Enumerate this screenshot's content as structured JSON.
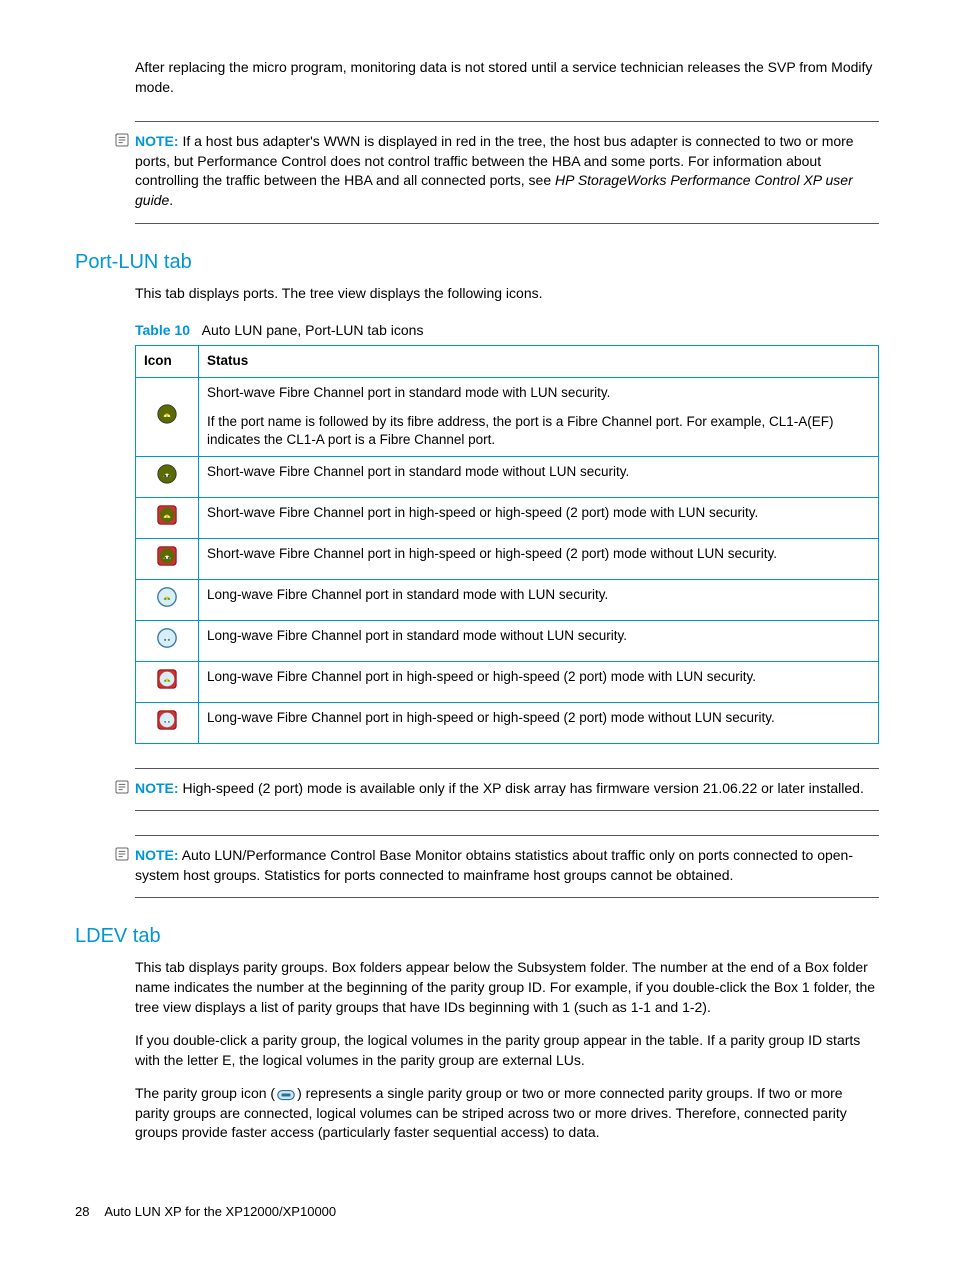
{
  "intro_paragraph": "After replacing the micro program, monitoring data is not stored until a service technician releases the SVP from Modify mode.",
  "note1": {
    "label": "NOTE:",
    "text_prefix": "If a host bus adapter's WWN is displayed in red in the tree, the host bus adapter is connected to two or more ports, but Performance Control does not control traffic between the HBA and some ports. For information about controlling the traffic between the HBA and all connected ports, see ",
    "italic": "HP StorageWorks Performance Control XP user guide",
    "text_suffix": "."
  },
  "port_lun": {
    "heading": "Port-LUN tab",
    "intro": "This tab displays ports. The tree view displays the following icons.",
    "table_label": "Table 10",
    "table_caption": "Auto LUN pane, Port-LUN tab icons",
    "columns": {
      "icon": "Icon",
      "status": "Status"
    },
    "rows": [
      {
        "icon_name": "sw-std-lun",
        "status_line1": "Short-wave Fibre Channel port in standard mode with LUN security.",
        "status_line2": "If the port name is followed by its fibre address, the port is a Fibre Channel port. For example, CL1-A(EF) indicates the CL1-A port is a Fibre Channel port."
      },
      {
        "icon_name": "sw-std-nolun",
        "status": "Short-wave Fibre Channel port in standard mode without LUN security."
      },
      {
        "icon_name": "sw-hs-lun",
        "status": "Short-wave Fibre Channel port in high-speed or high-speed (2 port) mode with LUN security."
      },
      {
        "icon_name": "sw-hs-nolun",
        "status": "Short-wave Fibre Channel port in high-speed or high-speed (2 port) mode without LUN security."
      },
      {
        "icon_name": "lw-std-lun",
        "status": "Long-wave Fibre Channel port in standard mode with LUN security."
      },
      {
        "icon_name": "lw-std-nolun",
        "status": "Long-wave Fibre Channel port in standard mode without LUN security."
      },
      {
        "icon_name": "lw-hs-lun",
        "status": "Long-wave Fibre Channel port in high-speed or high-speed (2 port) mode with LUN security."
      },
      {
        "icon_name": "lw-hs-nolun",
        "status": "Long-wave Fibre Channel port in high-speed or high-speed (2 port) mode without LUN security."
      }
    ]
  },
  "note2": {
    "label": "NOTE:",
    "text": "High-speed (2 port) mode is available only if the XP disk array has firmware version 21.06.22 or later installed."
  },
  "note3": {
    "label": "NOTE:",
    "text": "Auto LUN/Performance Control Base Monitor obtains statistics about traffic only on ports connected to open-system host groups. Statistics for ports connected to mainframe host groups cannot be obtained."
  },
  "ldev": {
    "heading": "LDEV tab",
    "para1": "This tab displays parity groups. Box folders appear below the Subsystem folder. The number at the end of a Box folder name indicates the number at the beginning of the parity group ID. For example, if you double-click the Box 1 folder, the tree view displays a list of parity groups that have IDs beginning with 1 (such as 1-1 and 1-2).",
    "para2": "If you double-click a parity group, the logical volumes in the parity group appear in the table. If a parity group ID starts with the letter E, the logical volumes in the parity group are external LUs.",
    "para3_prefix": "The parity group icon (",
    "para3_suffix": ") represents a single parity group or two or more connected parity groups. If two or more parity groups are connected, logical volumes can be striped across two or more drives. Therefore, connected parity groups provide faster access (particularly faster sequential access) to data."
  },
  "footer": {
    "page": "28",
    "title": "Auto LUN XP for the XP12000/XP10000"
  }
}
